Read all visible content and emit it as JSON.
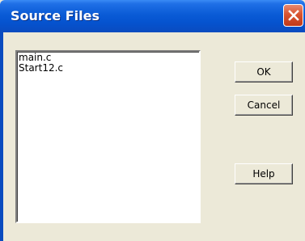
{
  "window": {
    "title": "Source Files"
  },
  "file_list": {
    "items": [
      "main.c",
      "Start12.c"
    ]
  },
  "buttons": {
    "ok": "OK",
    "cancel": "Cancel",
    "help": "Help"
  },
  "icons": {
    "close": "close-icon"
  }
}
